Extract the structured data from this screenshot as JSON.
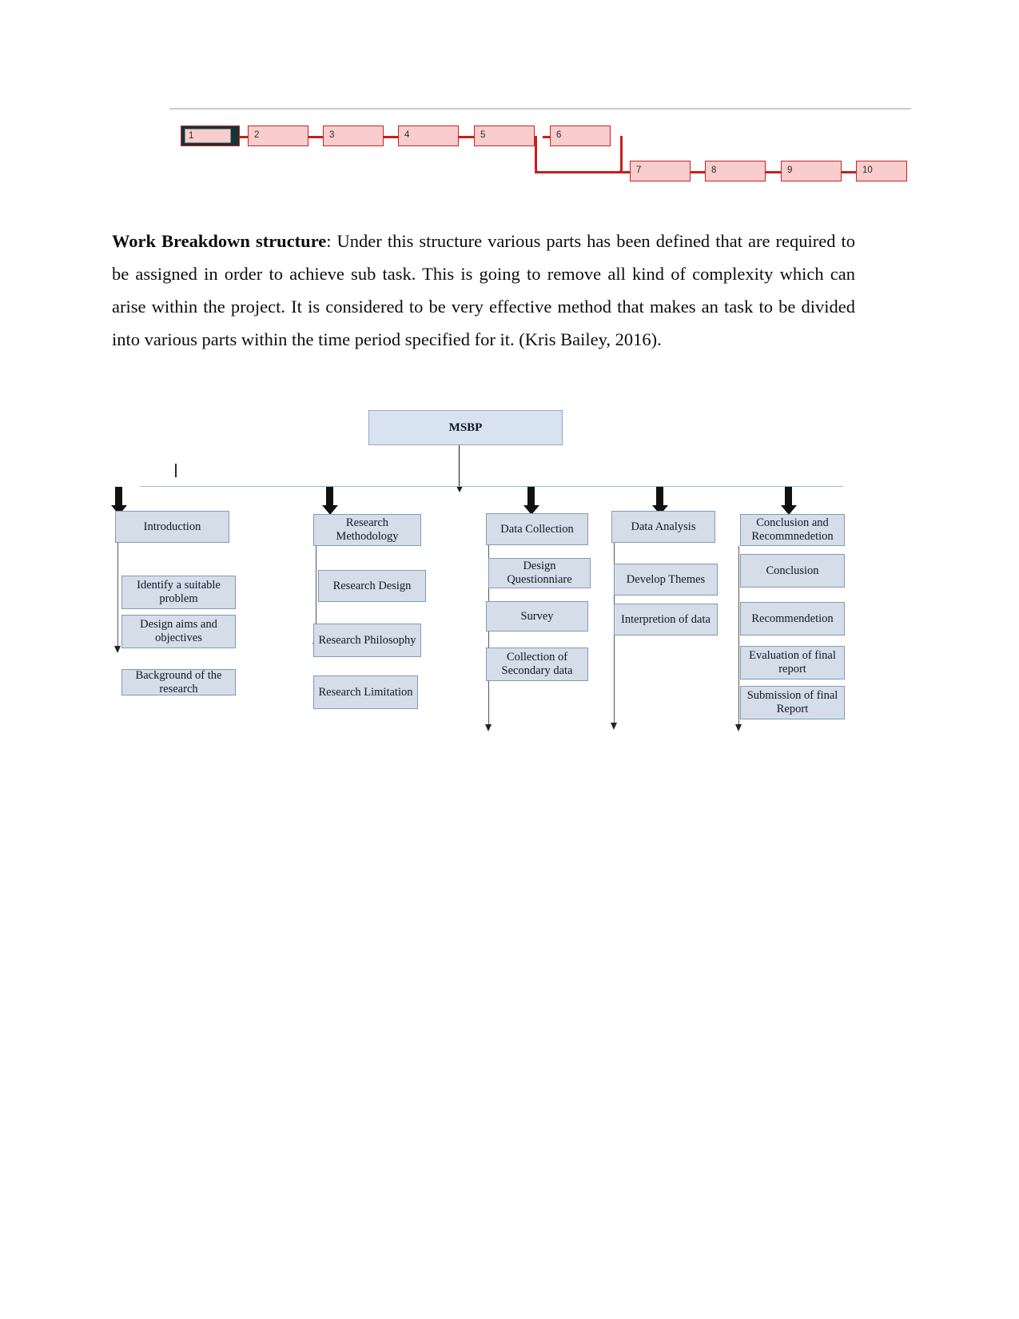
{
  "document": {
    "network_diagram": {
      "title": "network-diagram",
      "nodes": [
        {
          "id": "1",
          "label": "1",
          "selected": true
        },
        {
          "id": "2",
          "label": "2",
          "selected": false
        },
        {
          "id": "3",
          "label": "3",
          "selected": false
        },
        {
          "id": "4",
          "label": "4",
          "selected": false
        },
        {
          "id": "5",
          "label": "5",
          "selected": false
        },
        {
          "id": "6",
          "label": "6",
          "selected": false
        },
        {
          "id": "7",
          "label": "7",
          "selected": false
        },
        {
          "id": "8",
          "label": "8",
          "selected": false
        },
        {
          "id": "9",
          "label": "9",
          "selected": false
        },
        {
          "id": "10",
          "label": "10",
          "selected": false
        }
      ],
      "node_labels": {
        "n1": "1",
        "n2": "2",
        "n3": "3",
        "n4": "4",
        "n5": "5",
        "n6": "6",
        "n7": "7",
        "n8": "8",
        "n9": "9",
        "n10": "10"
      },
      "colors": {
        "node_fill": "#f9cdcd",
        "node_border": "#d02020",
        "connector": "#c81e1e",
        "selected_border": "#123535"
      }
    },
    "paragraph": {
      "lead": "Work Breakdown structure",
      "body": ": Under this structure various parts has been defined that are required to be assigned in order to achieve sub task. This is going to remove all kind of complexity which can arise within the project. It is considered to be very effective method that makes an task to be divided into various parts within the time period specified for it. (Kris Bailey, 2016)."
    },
    "wbs": {
      "root": "MSBP",
      "colors": {
        "box_fill": "#d5dde8",
        "box_border": "#7e9cbb",
        "root_fill": "#d8e2f0",
        "root_border": "#8ea9c8",
        "connector": "#9fb6cf",
        "arrow": "#111111"
      },
      "branches": [
        {
          "head": "Introduction",
          "children": [
            "Identify a suitable problem",
            "Design aims and objectives",
            "Background of the research"
          ]
        },
        {
          "head": "Research Methodology",
          "children": [
            "Research Design",
            "Research Philosophy",
            "Research Limitation"
          ]
        },
        {
          "head": "Data Collection",
          "children": [
            "Design Questionniare",
            "Survey",
            "Collection of Secondary data"
          ]
        },
        {
          "head": "Data Analysis",
          "children": [
            "Develop Themes",
            "Interpretion of data"
          ]
        },
        {
          "head": "Conclusion and Recommnedetion",
          "children": [
            "Conclusion",
            "Recommendetion",
            "Evaluation of final report",
            "Submission of final Report"
          ]
        }
      ]
    }
  }
}
